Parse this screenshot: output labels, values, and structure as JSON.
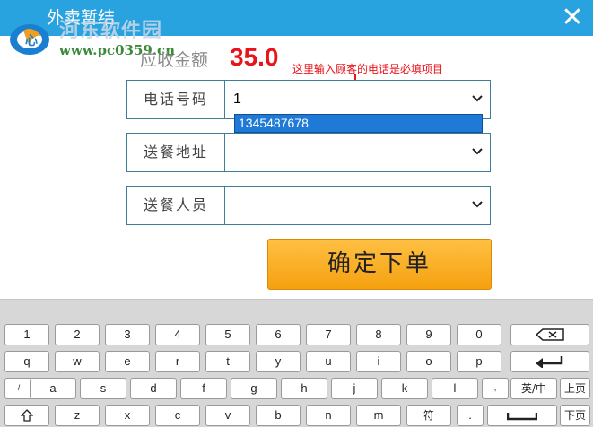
{
  "window": {
    "title": "外卖暂结",
    "close_glyph": "✕"
  },
  "watermark": {
    "site_name": "河东软件园",
    "url": "www.pc0359.cn"
  },
  "amount": {
    "label": "应收金额",
    "value": "35.0"
  },
  "annotation": {
    "text": "这里输入顾客的电话是必填项目"
  },
  "form": {
    "phone": {
      "label": "电话号码",
      "value": "1"
    },
    "address": {
      "label": "送餐地址",
      "value": ""
    },
    "courier": {
      "label": "送餐人员",
      "value": ""
    }
  },
  "dropdown": {
    "options": [
      "1345487678"
    ]
  },
  "confirm_button": {
    "label": "确定下单"
  },
  "keyboard": {
    "row1": [
      "1",
      "2",
      "3",
      "4",
      "5",
      "6",
      "7",
      "8",
      "9",
      "0"
    ],
    "row2": [
      "q",
      "w",
      "e",
      "r",
      "t",
      "y",
      "u",
      "i",
      "o",
      "p"
    ],
    "row3": [
      "/",
      "a",
      "s",
      "d",
      "f",
      "g",
      "h",
      "j",
      "k",
      "l",
      ","
    ],
    "row4": [
      "z",
      "x",
      "c",
      "v",
      "b",
      "n",
      "m",
      "符",
      "."
    ],
    "lang_toggle": "英/中",
    "page_up": "上页",
    "page_down": "下页",
    "icons": {
      "backspace": "backspace-icon",
      "enter": "enter-icon",
      "shift": "shift-icon",
      "space": "space-icon"
    }
  },
  "colors": {
    "titlebar": "#29a3e0",
    "amount": "#e8141b",
    "dropdown_highlight": "#1e7ad6",
    "confirm": "#f5a10f"
  }
}
